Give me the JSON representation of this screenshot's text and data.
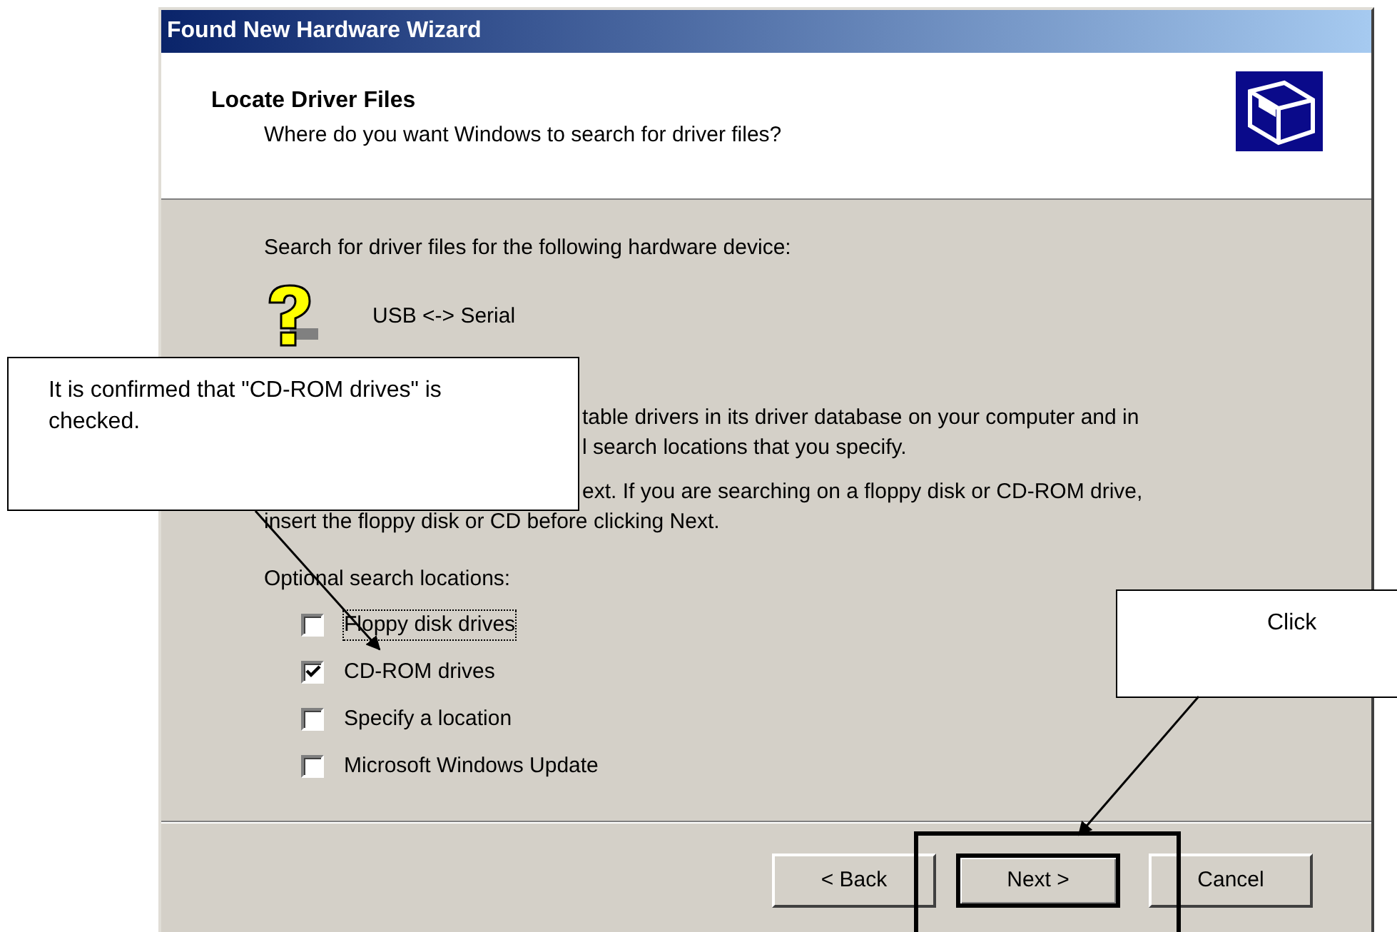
{
  "window": {
    "title": "Found New Hardware Wizard"
  },
  "header": {
    "title": "Locate Driver Files",
    "subtitle": "Where do you want Windows to search for driver files?"
  },
  "body": {
    "intro": "Search for driver files for the following hardware device:",
    "device": "USB <-> Serial",
    "paragraphs": [
      {
        "lines": [
          {
            "text": "table drivers in its driver database on your computer and in",
            "partly_covered": true
          },
          {
            "text": "l search locations that you specify.",
            "partly_covered": true
          }
        ]
      },
      {
        "lines": [
          {
            "text": "ext. If you are searching on a floppy disk or CD-ROM drive,",
            "partly_covered": true
          },
          {
            "text": "insert the floppy disk or CD before clicking Next.",
            "partly_covered": false
          }
        ]
      }
    ],
    "options_label": "Optional search locations:",
    "options": [
      {
        "label": "Floppy disk drives",
        "checked": false,
        "focused": true
      },
      {
        "label": "CD-ROM drives",
        "checked": true,
        "focused": false
      },
      {
        "label": "Specify a location",
        "checked": false,
        "focused": false
      },
      {
        "label": "Microsoft Windows Update",
        "checked": false,
        "focused": false
      }
    ]
  },
  "buttons": [
    {
      "label": "< Back",
      "highlighted": false
    },
    {
      "label": "Next >",
      "highlighted": true
    },
    {
      "label": "Cancel",
      "highlighted": false
    }
  ],
  "callouts": [
    {
      "text": "It is confirmed that \"CD-ROM drives\" is checked.",
      "kind": "left"
    },
    {
      "text": "Click",
      "kind": "right"
    }
  ]
}
